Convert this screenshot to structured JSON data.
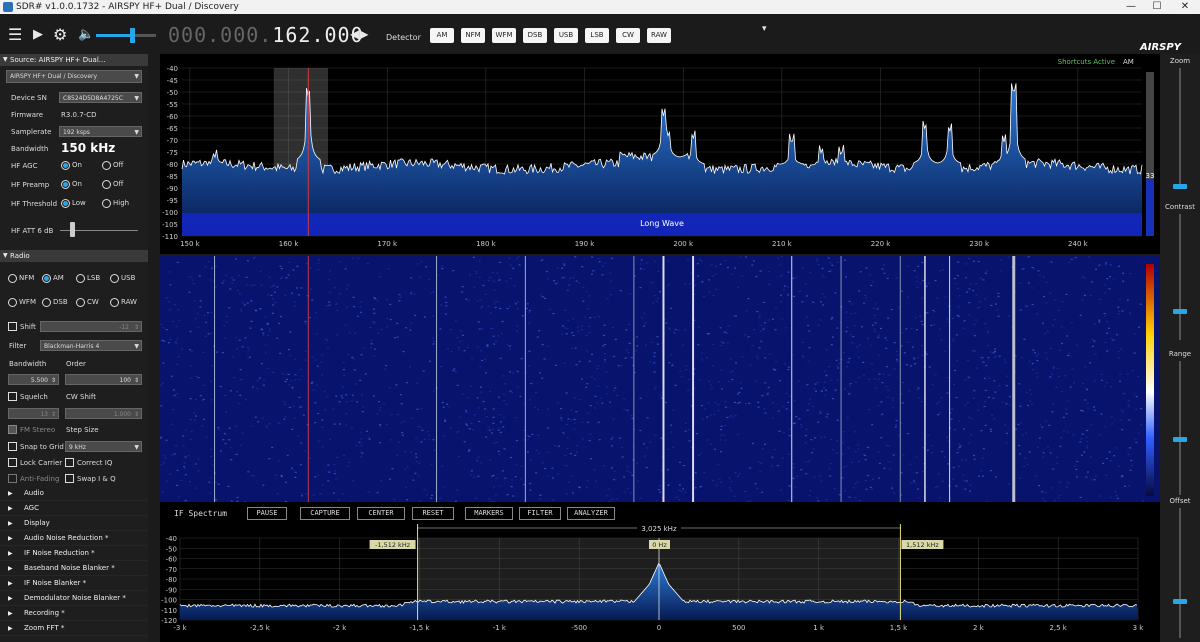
{
  "window": {
    "title": "SDR# v1.0.0.1732 - AIRSPY HF+ Dual / Discovery",
    "min": "—",
    "max": "☐",
    "close": "✕"
  },
  "toolbar": {
    "freq_dim": "000.000.",
    "freq_lit": "162.000",
    "detector_label": "Detector",
    "modes": [
      "AM",
      "NFM",
      "WFM",
      "DSB",
      "USB",
      "LSB",
      "CW",
      "RAW"
    ],
    "logo": "AIRSPY",
    "dropdown_arrow": "▾",
    "volume_level": 0.6
  },
  "source": {
    "header": "Source: AIRSPY HF+ Dual...",
    "device": "AIRSPY HF+ Dual / Discovery",
    "device_sn_label": "Device SN",
    "device_sn": "C8524D5D8A4725C",
    "firmware_label": "Firmware",
    "firmware": "R3.0.7-CD",
    "samplerate_label": "Samplerate",
    "samplerate": "192 ksps",
    "bandwidth_label": "Bandwidth",
    "bandwidth": "150 kHz",
    "agc_label": "HF AGC",
    "agc_on": "On",
    "agc_off": "Off",
    "preamp_label": "HF Preamp",
    "preamp_on": "On",
    "preamp_off": "Off",
    "threshold_label": "HF Threshold",
    "threshold_low": "Low",
    "threshold_high": "High",
    "att_label": "HF ATT 6 dB"
  },
  "radio": {
    "header": "Radio",
    "modes_row1": [
      "NFM",
      "AM",
      "LSB",
      "USB"
    ],
    "modes_row2": [
      "WFM",
      "DSB",
      "CW",
      "RAW"
    ],
    "selected": "AM",
    "shift_label": "Shift",
    "shift_value": "-12",
    "filter_label": "Filter",
    "filter_value": "Blackman-Harris 4",
    "bandwidth_label": "Bandwidth",
    "order_label": "Order",
    "bandwidth_value": "5.500",
    "order_value": "100",
    "squelch_label": "Squelch",
    "cw_shift_label": "CW Shift",
    "squelch_value": "13",
    "cw_shift_value": "1.000",
    "fm_stereo_label": "FM Stereo",
    "step_size_label": "Step Size",
    "snap_label": "Snap to Grid",
    "snap_value": "9 kHz",
    "lock_carrier_label": "Lock Carrier",
    "correct_iq_label": "Correct IQ",
    "anti_fading_label": "Anti-Fading",
    "swap_iq_label": "Swap I & Q"
  },
  "plugins": [
    "Audio",
    "AGC",
    "Display",
    "Audio Noise Reduction *",
    "IF Noise Reduction *",
    "Baseband Noise Blanker *",
    "IF Noise Blanker *",
    "Demodulator Noise Blanker *",
    "Recording *",
    "Zoom FFT *"
  ],
  "right_controls": {
    "zoom": "Zoom",
    "contrast": "Contrast",
    "range": "Range",
    "offset": "Offset"
  },
  "spectrum": {
    "shortcuts": "Shortcuts Active",
    "mode": "AM",
    "band_label": "Long Wave",
    "level_readout": "33",
    "y_ticks": [
      "-40",
      "-45",
      "-50",
      "-55",
      "-60",
      "-65",
      "-70",
      "-75",
      "-80",
      "-85",
      "-90",
      "-95",
      "-100",
      "-105",
      "-110"
    ],
    "x_ticks": [
      "150 k",
      "160 k",
      "170 k",
      "180 k",
      "190 k",
      "200 k",
      "210 k",
      "220 k",
      "230 k",
      "240 k"
    ]
  },
  "ifspec": {
    "title": "IF Spectrum",
    "buttons": [
      "PAUSE",
      "CAPTURE",
      "CENTER",
      "RESET",
      "MARKERS",
      "FILTER",
      "ANALYZER"
    ],
    "bw_label": "3,025 kHz",
    "left_marker": "-1,512 kHz",
    "center_marker": "0 Hz",
    "right_marker": "1,512 kHz",
    "y_ticks": [
      "-40",
      "-50",
      "-60",
      "-70",
      "-80",
      "-90",
      "-100",
      "-110",
      "-120"
    ],
    "x_ticks": [
      "-3 k",
      "-2,5 k",
      "-2 k",
      "-1,5 k",
      "-1 k",
      "-500",
      "0",
      "500",
      "1 k",
      "1,5 k",
      "2 k",
      "2,5 k",
      "3 k"
    ]
  },
  "colors": {
    "accent": "#29a6e8",
    "spectrum_fill": "#1f5fb0",
    "waterfall_bg": "#08136e",
    "marker_yellow": "#e6e07a",
    "tune_line": "#d23a3a"
  }
}
